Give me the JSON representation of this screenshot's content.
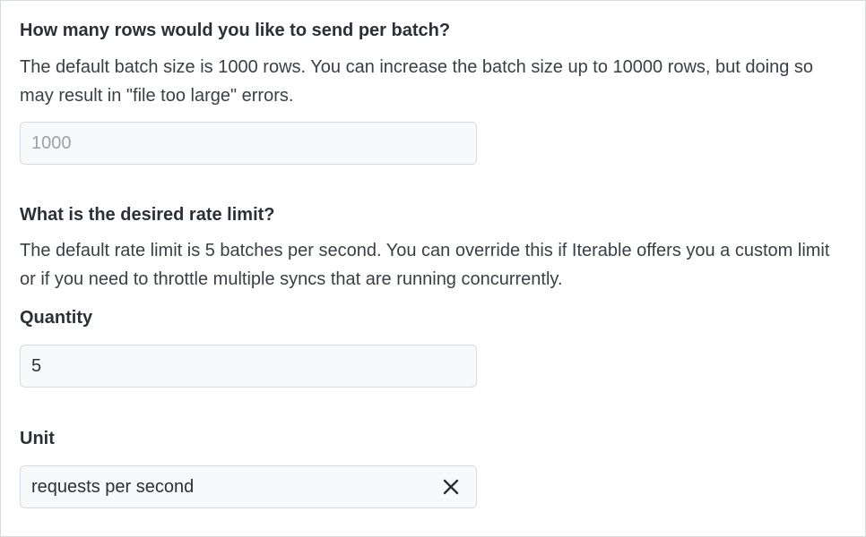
{
  "batch": {
    "title": "How many rows would you like to send per batch?",
    "description": "The default batch size is 1000 rows. You can increase the batch size up to 10000 rows, but doing so may result in \"file too large\" errors.",
    "input_value": "",
    "input_placeholder": "1000"
  },
  "rate_limit": {
    "title": "What is the desired rate limit?",
    "description": "The default rate limit is 5 batches per second. You can override this if Iterable offers you a custom limit or if you need to throttle multiple syncs that are running concurrently.",
    "quantity": {
      "label": "Quantity",
      "value": "5"
    },
    "unit": {
      "label": "Unit",
      "value": "requests per second",
      "clear_icon": "close-icon"
    }
  }
}
